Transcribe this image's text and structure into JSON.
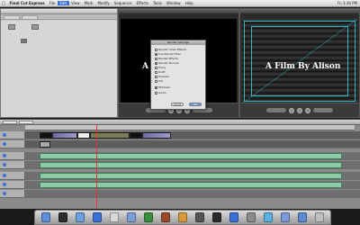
{
  "menubar": {
    "app_name": "Final Cut Express",
    "items": [
      "File",
      "Edit",
      "View",
      "Mark",
      "Modify",
      "Sequence",
      "Effects",
      "Tools",
      "Window",
      "Help"
    ],
    "highlighted_index": 1,
    "status_right": [
      "Fri 3:36 PM"
    ]
  },
  "viewer": {
    "overlay_text": "A F"
  },
  "canvas": {
    "overlay_text": "A Film By Alison"
  },
  "dialog": {
    "title": "Render Settings",
    "rows": [
      {
        "label": "Render Video Effects",
        "checked": false
      },
      {
        "label": "Use Render Files",
        "checked": true
      },
      {
        "label": "Render Effects",
        "checked": false
      },
      {
        "label": "Render Normal",
        "checked": true
      },
      {
        "label": "Proxy",
        "checked": false
      },
      {
        "label": "Draft",
        "checked": false
      },
      {
        "label": "Preview",
        "checked": false
      },
      {
        "label": "Full",
        "checked": false
      },
      {
        "label": "Mixdown",
        "checked": true
      },
      {
        "label": "Audio",
        "checked": false
      }
    ],
    "cancel_label": "Cancel",
    "ok_label": "OK"
  },
  "timeline": {
    "video_tracks": 2,
    "audio_tracks": 5
  },
  "dock": {
    "icons": [
      "finder-icon",
      "dashboard-icon",
      "mail-icon",
      "safari-icon",
      "ical-icon",
      "itunes-icon",
      "iphoto-icon",
      "imovie-icon",
      "garageband-icon",
      "idvd-icon",
      "final-cut-icon",
      "quicktime-icon",
      "system-preferences-icon",
      "photoshop-icon",
      "documents-icon",
      "folder-icon",
      "trash-icon"
    ],
    "colors": [
      "#5f8fd8",
      "#2b2b2b",
      "#6aa0e0",
      "#3b6fd8",
      "#d8d8d8",
      "#7aa0d8",
      "#3b8f3b",
      "#9a4a2a",
      "#d89a3a",
      "#555555",
      "#2a2a2a",
      "#3b6fd8",
      "#8a8a8a",
      "#5ab0e0",
      "#7a9ad8",
      "#5a8ad0",
      "#bfbfbf"
    ]
  }
}
